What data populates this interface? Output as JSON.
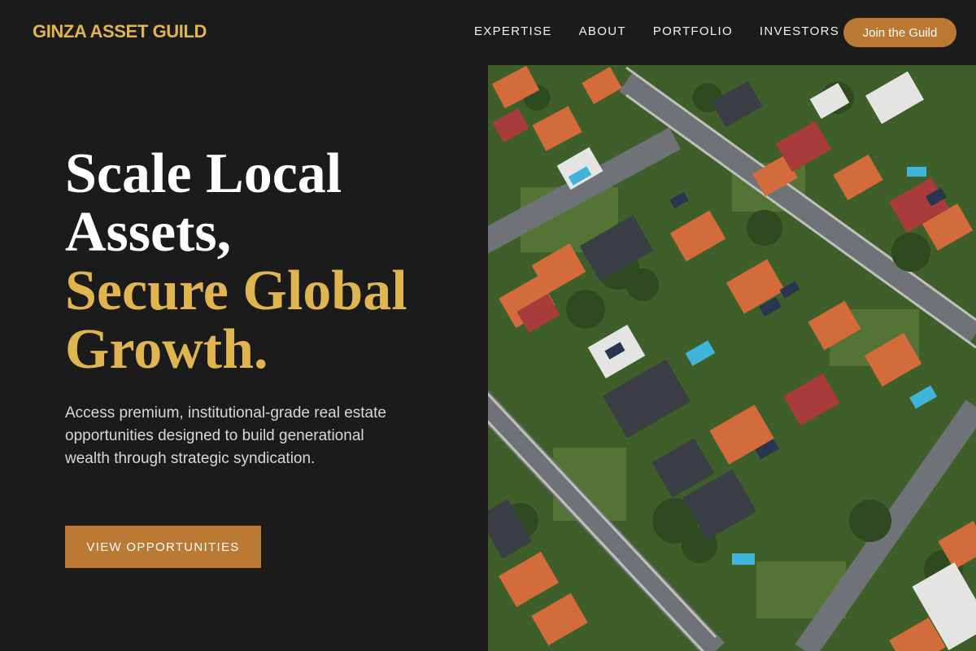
{
  "header": {
    "logo": "GINZA ASSET GUILD",
    "nav": [
      "EXPERTISE",
      "ABOUT",
      "PORTFOLIO",
      "INVESTORS"
    ],
    "cta": "Join the Guild"
  },
  "hero": {
    "title_white": [
      "Scale Local",
      "Assets,"
    ],
    "title_gold": [
      "Secure Global",
      "Growth."
    ],
    "description": "Access premium, institutional-grade real estate opportunities designed to build generational wealth through strategic syndication.",
    "cta": "VIEW OPPORTUNITIES"
  },
  "image": {
    "subject": "aerial-suburban-neighborhood"
  },
  "colors": {
    "background": "#1b1b1b",
    "accent_gold": "#e0b44f",
    "button_copper": "#bb7a34",
    "text_light": "#d8d8d8"
  }
}
